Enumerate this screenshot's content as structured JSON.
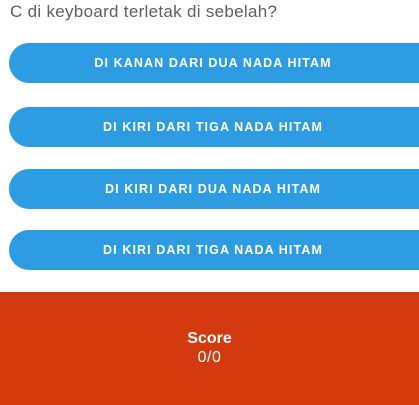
{
  "quiz": {
    "question": "C di keyboard terletak di sebelah?",
    "answers": [
      "DI KANAN DARI DUA NADA HITAM",
      "DI KIRI DARI TIGA NADA HITAM",
      "DI KIRI DARI DUA NADA HITAM",
      "DI KIRI DARI TIGA NADA HITAM"
    ]
  },
  "score": {
    "label": "Score",
    "value": "0/0"
  },
  "colors": {
    "button": "#2d9ce3",
    "score_panel": "#d33a0f",
    "question_text": "#5f5f5f"
  }
}
